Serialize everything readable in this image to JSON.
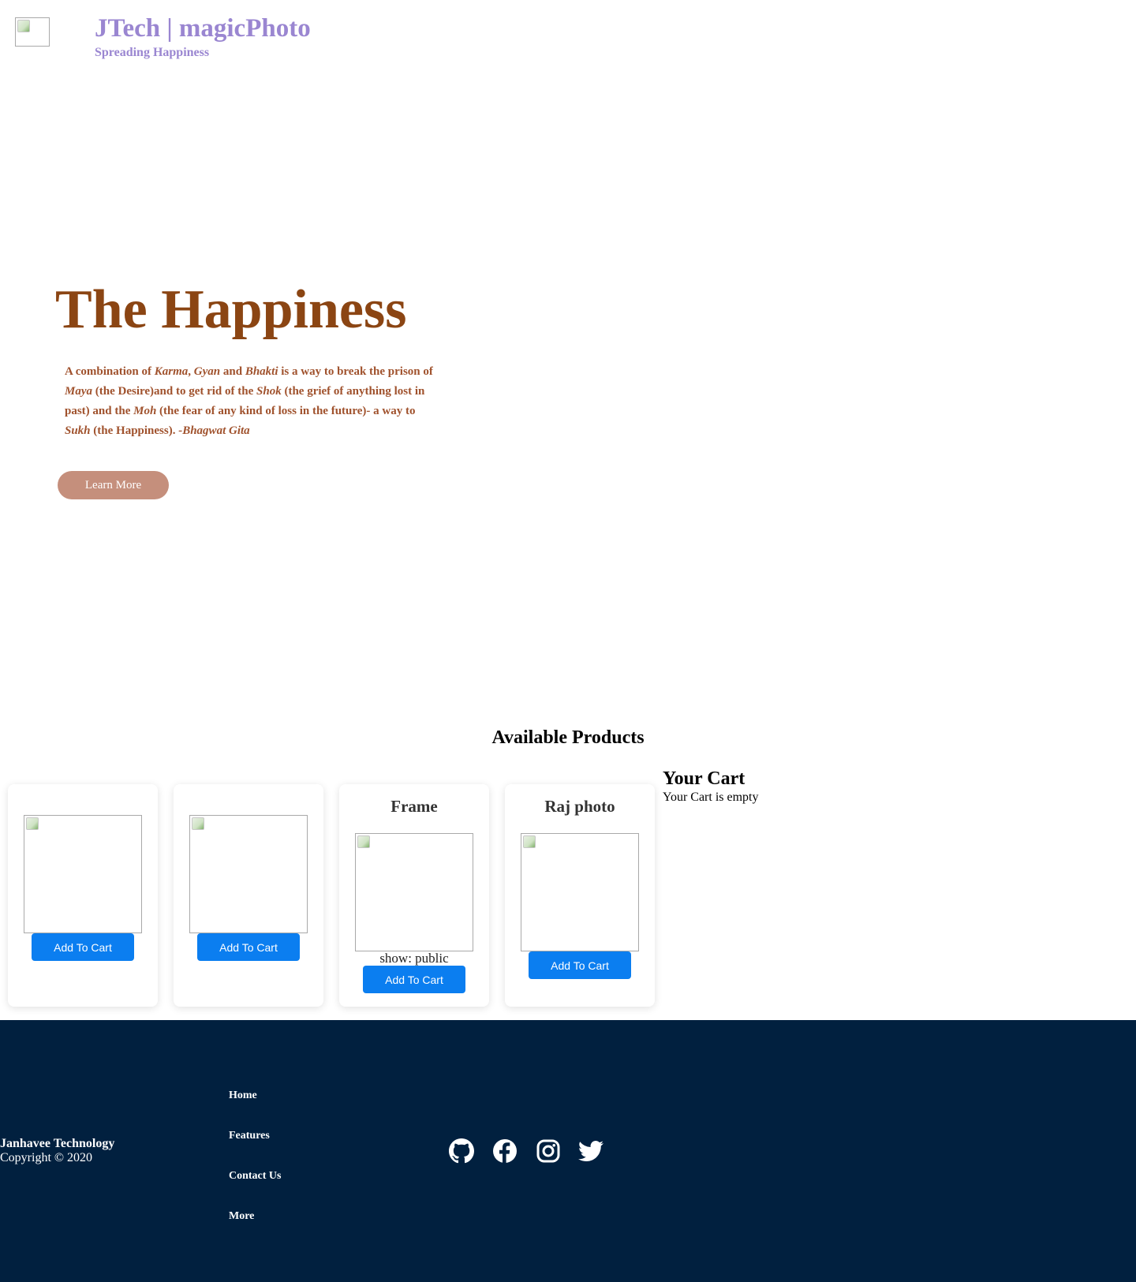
{
  "header": {
    "title": "JTech | magicPhoto",
    "tagline": "Spreading Happiness",
    "logo_icon": "broken-image-icon"
  },
  "hero": {
    "title": "The Happiness",
    "quote": {
      "p1": "A combination of ",
      "karma": "Karma",
      "comma": ", ",
      "gyan": "Gyan",
      "and": " and ",
      "bhakti": "Bhakti",
      "p2": " is a way to break the prison of ",
      "maya": "Maya",
      "p3": " (the Desire)and to get rid of the ",
      "shok": "Shok",
      "p4": " (the grief of anything lost in past) and the ",
      "moh": "Moh",
      "p5": " (the fear of any kind of loss in the future)- a way to ",
      "sukh": "Sukh",
      "p6": " (the Happiness). ",
      "source": "-Bhagwat Gita"
    },
    "button_label": "Learn More"
  },
  "products": {
    "heading": "Available Products",
    "items": [
      {
        "title": "",
        "show_text": "",
        "button_label": "Add To Cart"
      },
      {
        "title": "",
        "show_text": "",
        "button_label": "Add To Cart"
      },
      {
        "title": "Frame",
        "show_text": "show: public",
        "button_label": "Add To Cart"
      },
      {
        "title": "Raj photo",
        "show_text": "",
        "button_label": "Add To Cart"
      }
    ]
  },
  "cart": {
    "heading": "Your Cart",
    "empty_message": "Your Cart is empty"
  },
  "footer": {
    "company": "Janhavee Technology",
    "copyright": "Copyright © 2020",
    "links": [
      "Home",
      "Features",
      "Contact Us",
      "More"
    ],
    "social_icons": [
      "github-icon",
      "facebook-icon",
      "instagram-icon",
      "twitter-icon"
    ]
  },
  "colors": {
    "brand": "#9a86d1",
    "hero_title": "#8b4513",
    "hero_text": "#a0522d",
    "learn_more_bg": "#c58f7c",
    "cart_button": "#0b7ef0",
    "footer_bg": "#01203f"
  }
}
